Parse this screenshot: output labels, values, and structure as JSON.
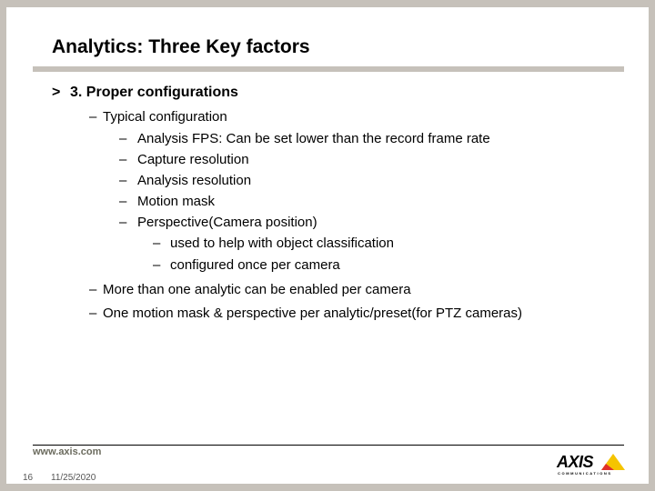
{
  "slide": {
    "title": "Analytics: Three Key factors",
    "heading": {
      "bullet": ">",
      "text": "3. Proper configurations"
    },
    "items": [
      {
        "dash": "–",
        "text": "Typical configuration"
      },
      {
        "dash": "–",
        "text": "Analysis FPS: Can be set lower than the record frame rate"
      },
      {
        "dash": "–",
        "text": "Capture resolution"
      },
      {
        "dash": "–",
        "text": "Analysis resolution"
      },
      {
        "dash": "–",
        "text": "Motion mask"
      },
      {
        "dash": "–",
        "text": "Perspective(Camera position)"
      },
      {
        "dash": "–",
        "text": "used to help with object classification"
      },
      {
        "dash": "–",
        "text": "configured once per camera"
      },
      {
        "dash": "–",
        "text": "More than one analytic can be enabled per camera"
      },
      {
        "dash": "–",
        "text": "One motion mask & perspective per analytic/preset(for PTZ cameras)"
      }
    ]
  },
  "footer": {
    "url": "www.axis.com",
    "page_number": "16",
    "date": "11/25/2020",
    "logo": {
      "name": "AXIS",
      "tagline": "COMMUNICATIONS",
      "colors": {
        "yellow": "#f5c400",
        "red": "#e0302a"
      }
    }
  }
}
